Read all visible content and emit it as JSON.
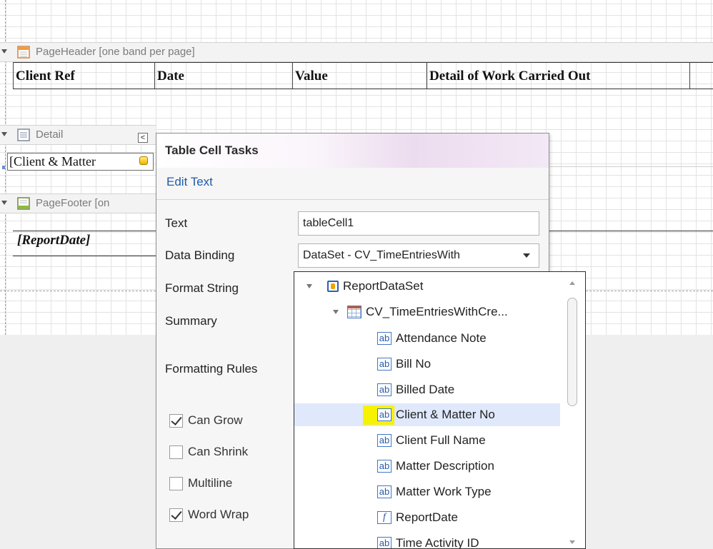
{
  "bands": {
    "page_header": {
      "label": "PageHeader [one band per page]"
    },
    "detail": {
      "label": "Detail",
      "collapse_glyph": "<"
    },
    "page_footer": {
      "label": "PageFooter [on"
    }
  },
  "header_cells": [
    "Client Ref",
    "Date",
    "Value",
    "Detail of Work Carried Out"
  ],
  "detail_cell": {
    "text": "[Client & Matter"
  },
  "footer_cell": {
    "text": "[ReportDate]"
  },
  "tasks_panel": {
    "title": "Table Cell Tasks",
    "edit_text_link": "Edit Text",
    "labels": {
      "text": "Text",
      "data_binding": "Data Binding",
      "format_string": "Format String",
      "summary": "Summary",
      "formatting_rules": "Formatting Rules"
    },
    "text_value": "tableCell1",
    "data_binding_value": "DataSet - CV_TimeEntriesWith",
    "checkboxes": [
      {
        "label": "Can Grow",
        "checked": true
      },
      {
        "label": "Can Shrink",
        "checked": false
      },
      {
        "label": "Multiline",
        "checked": false
      },
      {
        "label": "Word Wrap",
        "checked": true
      }
    ]
  },
  "field_list": {
    "root": "ReportDataSet",
    "table": "CV_TimeEntriesWithCre...",
    "fields": [
      {
        "label": "Attendance Note",
        "icon": "ab"
      },
      {
        "label": "Bill No",
        "icon": "ab"
      },
      {
        "label": "Billed Date",
        "icon": "ab"
      },
      {
        "label": "Client & Matter No",
        "icon": "ab",
        "selected": true
      },
      {
        "label": "Client Full Name",
        "icon": "ab"
      },
      {
        "label": "Matter Description",
        "icon": "ab"
      },
      {
        "label": "Matter Work Type",
        "icon": "ab"
      },
      {
        "label": "ReportDate",
        "icon": "f"
      },
      {
        "label": "Time Activity ID",
        "icon": "ab"
      }
    ],
    "selected_field": "Client & Matter No"
  },
  "colors": {
    "link": "#1f5ca8",
    "highlight": "#f7f200",
    "selection": "#dfe9fb"
  }
}
